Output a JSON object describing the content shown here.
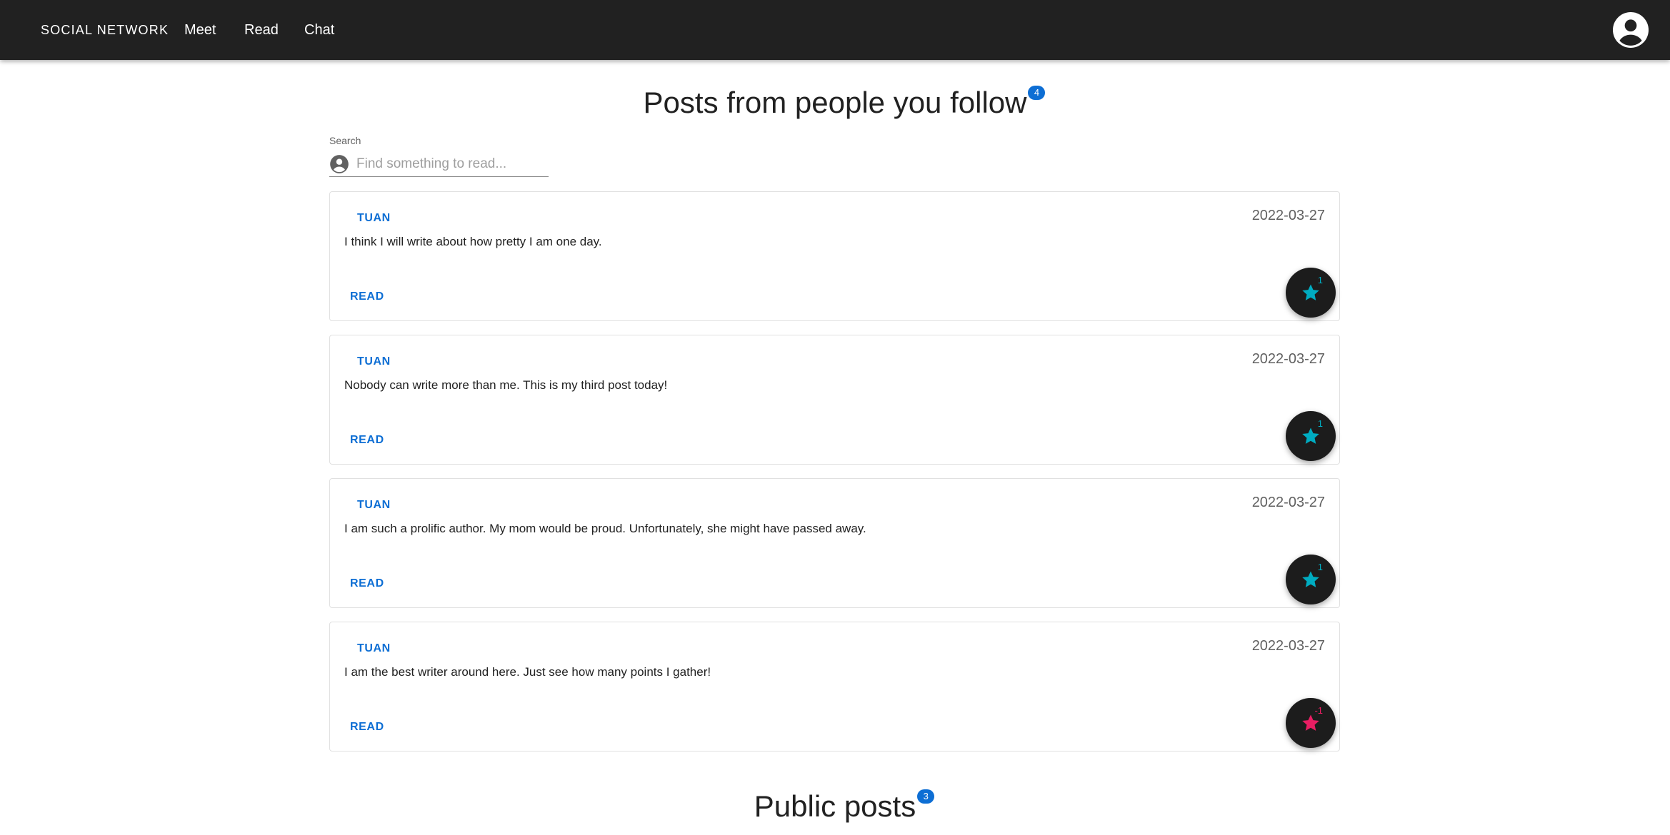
{
  "appbar": {
    "brand": "SOCIAL NETWORK",
    "nav": [
      {
        "label": "Meet"
      },
      {
        "label": "Read"
      },
      {
        "label": "Chat"
      }
    ],
    "account_icon": "account-circle-icon"
  },
  "follow_section": {
    "title": "Posts from people you follow",
    "count": "4"
  },
  "search": {
    "label": "Search",
    "placeholder": "Find something to read...",
    "value": "",
    "icon": "account-circle-icon"
  },
  "posts": [
    {
      "author": "TUAN",
      "date": "2022-03-27",
      "text": "I think I will write about how pretty I am one day.",
      "read_label": "READ",
      "points": "1",
      "star_color": "#00acc1"
    },
    {
      "author": "TUAN",
      "date": "2022-03-27",
      "text": "Nobody can write more than me. This is my third post today!",
      "read_label": "READ",
      "points": "1",
      "star_color": "#00acc1"
    },
    {
      "author": "TUAN",
      "date": "2022-03-27",
      "text": "I am such a prolific author. My mom would be proud. Unfortunately, she might have passed away.",
      "read_label": "READ",
      "points": "1",
      "star_color": "#00acc1"
    },
    {
      "author": "TUAN",
      "date": "2022-03-27",
      "text": "I am the best writer around here. Just see how many points I gather!",
      "read_label": "READ",
      "points": "-1",
      "star_color": "#e91e63"
    }
  ],
  "public_section": {
    "title": "Public posts",
    "count": "3"
  },
  "colors": {
    "appbar_bg": "#212121",
    "accent_blue": "#0d6ed4",
    "star_positive": "#00acc1",
    "star_negative": "#e91e63"
  }
}
